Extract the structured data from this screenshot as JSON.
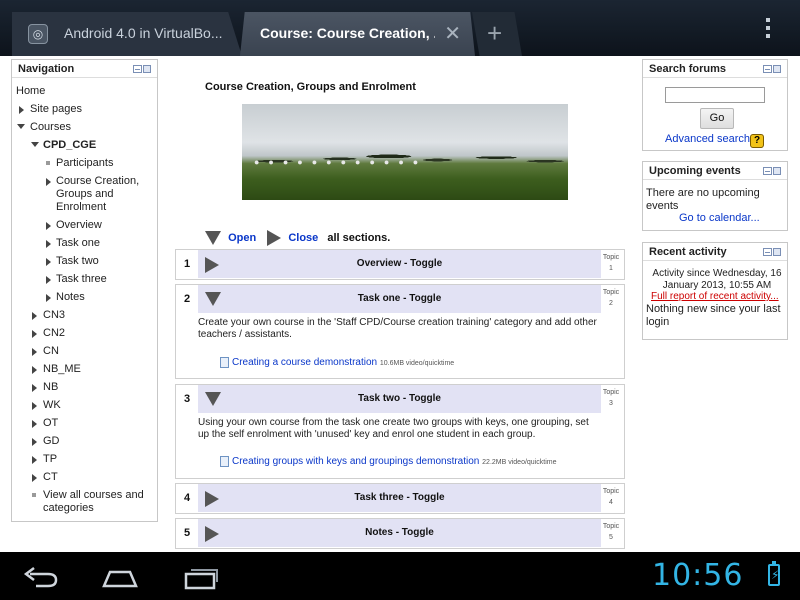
{
  "browser": {
    "tabs": [
      {
        "title": "Android 4.0 in VirtualBo..."
      },
      {
        "title": "Course: Course Creation, ..."
      }
    ]
  },
  "nav": {
    "title": "Navigation",
    "items": [
      {
        "label": "Home",
        "type": "link"
      },
      {
        "label": "Site pages"
      },
      {
        "label": "Courses",
        "type": "link"
      },
      {
        "label": "CPD_CGE",
        "type": "link"
      },
      {
        "label": "Participants"
      },
      {
        "label": "Course Creation, Groups and Enrolment"
      },
      {
        "label": "Overview"
      },
      {
        "label": "Task one"
      },
      {
        "label": "Task two"
      },
      {
        "label": "Task three"
      },
      {
        "label": "Notes"
      },
      {
        "label": "CN3"
      },
      {
        "label": "CN2"
      },
      {
        "label": "CN"
      },
      {
        "label": "NB_ME"
      },
      {
        "label": "NB"
      },
      {
        "label": "WK"
      },
      {
        "label": "OT"
      },
      {
        "label": "GD"
      },
      {
        "label": "TP"
      },
      {
        "label": "CT"
      },
      {
        "label": "View all courses and categories"
      }
    ]
  },
  "course": {
    "title": "Course Creation, Groups and Enrolment",
    "open_label": "Open",
    "close_label": "Close",
    "all_sections": "all sections."
  },
  "sections": [
    {
      "num": "1",
      "title": "Overview - Toggle",
      "topic_label": "Topic",
      "topic_num": "1"
    },
    {
      "num": "2",
      "title": "Task one - Toggle",
      "topic_label": "Topic",
      "topic_num": "2",
      "text": "Create your own course in the 'Staff CPD/Course creation training' category and add other teachers / assistants.",
      "resource": "Creating a course demonstration",
      "resource_meta": "10.6MB video/quicktime"
    },
    {
      "num": "3",
      "title": "Task two - Toggle",
      "topic_label": "Topic",
      "topic_num": "3",
      "text": "Using your own course from the task one create two groups with keys, one grouping, set up the self enrolment with 'unused' key and enrol one student in each group.",
      "resource": "Creating groups with keys and groupings demonstration",
      "resource_meta": "22.2MB video/quicktime"
    },
    {
      "num": "4",
      "title": "Task three - Toggle",
      "topic_label": "Topic",
      "topic_num": "4"
    },
    {
      "num": "5",
      "title": "Notes - Toggle",
      "topic_label": "Topic",
      "topic_num": "5"
    }
  ],
  "search": {
    "title": "Search forums",
    "go": "Go",
    "advanced": "Advanced search",
    "value": "",
    "help": "?"
  },
  "events": {
    "title": "Upcoming events",
    "text": "There are no upcoming events",
    "calendar": "Go to calendar..."
  },
  "activity": {
    "title": "Recent activity",
    "since": "Activity since Wednesday, 16 January 2013, 10:55 AM",
    "full": "Full report of recent activity...",
    "none": "Nothing new since your last login"
  },
  "system": {
    "time": "10:56"
  },
  "colors": {
    "clock": "#33b5e5",
    "link": "#0a37c9",
    "section_header": "#e2e2f4"
  }
}
